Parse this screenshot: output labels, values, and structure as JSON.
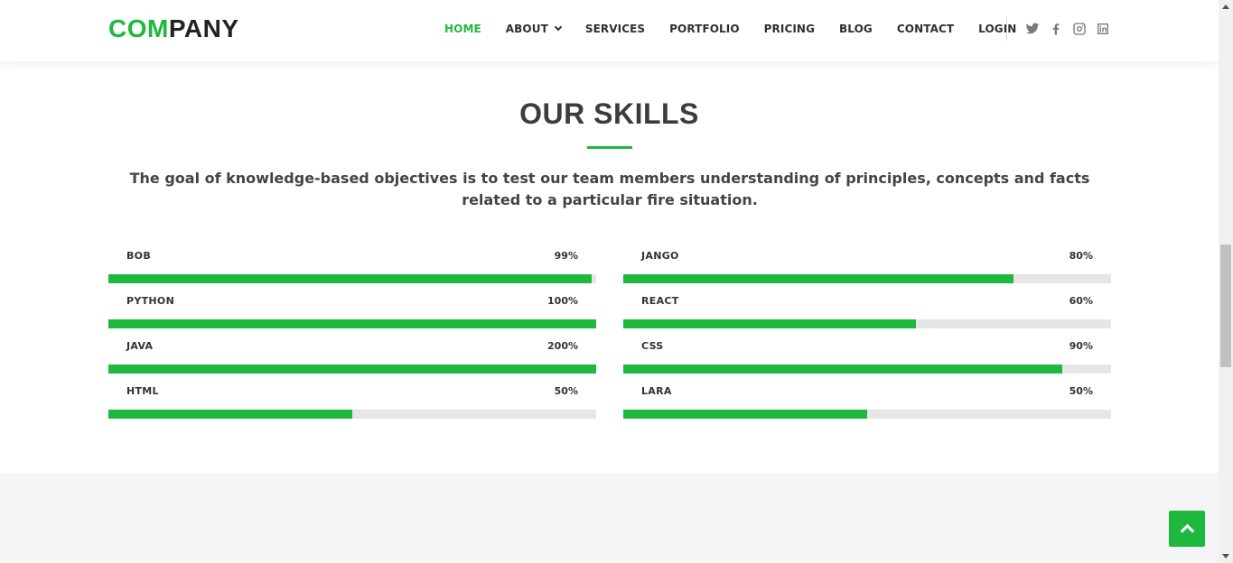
{
  "header": {
    "logo_part1": "COM",
    "logo_part2": "PANY",
    "nav": [
      {
        "label": "HOME",
        "active": true
      },
      {
        "label": "ABOUT",
        "dropdown": true
      },
      {
        "label": "SERVICES"
      },
      {
        "label": "PORTFOLIO"
      },
      {
        "label": "PRICING"
      },
      {
        "label": "BLOG"
      },
      {
        "label": "CONTACT"
      },
      {
        "label": "LOGIN"
      }
    ],
    "socials": [
      "twitter-icon",
      "facebook-icon",
      "instagram-icon",
      "linkedin-icon"
    ]
  },
  "skills": {
    "title": "OUR SKILLS",
    "lead": "The goal of knowledge-based objectives is to test our team members understanding of principles, concepts and facts related to a particular fire situation.",
    "left": [
      {
        "name": "BOB",
        "value": "99%",
        "fill": 0.99
      },
      {
        "name": "PYTHON",
        "value": "100%",
        "fill": 1.0
      },
      {
        "name": "JAVA",
        "value": "200%",
        "fill": 1.0
      },
      {
        "name": "HTML",
        "value": "50%",
        "fill": 0.5
      }
    ],
    "right": [
      {
        "name": "JANGO",
        "value": "80%",
        "fill": 0.8
      },
      {
        "name": "REACT",
        "value": "60%",
        "fill": 0.6
      },
      {
        "name": "CSS",
        "value": "90%",
        "fill": 0.9
      },
      {
        "name": "LARA",
        "value": "50%",
        "fill": 0.5
      }
    ]
  },
  "colors": {
    "accent": "#1fb83f",
    "track": "#e6e6e6",
    "heading": "#3f3b38"
  },
  "back_to_top_icon": "chevron-up-icon"
}
